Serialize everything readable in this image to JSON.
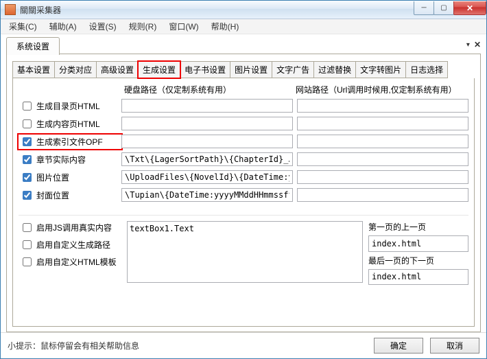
{
  "window": {
    "title": "關關采集器",
    "minimize": "─",
    "maximize": "▢",
    "close": "✕"
  },
  "menu": {
    "collect": "采集(C)",
    "assist": "辅助(A)",
    "settings": "设置(S)",
    "rules": "规则(R)",
    "window": "窗口(W)",
    "help": "帮助(H)"
  },
  "outer_tab": {
    "label": "系统设置",
    "dropdown": "▾",
    "close": "✕"
  },
  "inner_tabs": {
    "basic": "基本设置",
    "classify": "分类对应",
    "advanced": "高级设置",
    "generate": "生成设置",
    "ebook": "电子书设置",
    "image": "图片设置",
    "textad": "文字广告",
    "filter": "过滤替换",
    "text2img": "文字转图片",
    "logsel": "日志选择"
  },
  "headers": {
    "blank": "",
    "disk": "硬盘路径（仅定制系统有用）",
    "site": "网站路径（Url调用时候用,仅定制系统有用）"
  },
  "rows": {
    "gen_dir": {
      "label": "生成目录页HTML",
      "checked": false,
      "disk": "",
      "site": ""
    },
    "gen_content": {
      "label": "生成内容页HTML",
      "checked": false,
      "disk": "",
      "site": ""
    },
    "gen_index_opf": {
      "label": "生成索引文件OPF",
      "checked": true,
      "disk": "",
      "site": ""
    },
    "chapter_real": {
      "label": "章节实际内容",
      "checked": true,
      "disk": "\\Txt\\{LagerSortPath}\\{ChapterId}_Jie.Txt",
      "site": ""
    },
    "img_loc": {
      "label": "图片位置",
      "checked": true,
      "disk": "\\UploadFiles\\{NovelId}\\{DateTime:yyyyMMd",
      "site": ""
    },
    "cover_loc": {
      "label": "封面位置",
      "checked": true,
      "disk": "\\Tupian\\{DateTime:yyyyMMddHHmmssffff}.jp",
      "site": ""
    }
  },
  "lower": {
    "enable_js": {
      "label": "启用JS调用真实内容",
      "checked": false
    },
    "enable_custom_path": {
      "label": "启用自定义生成路径",
      "checked": false
    },
    "enable_custom_tpl": {
      "label": "启用自定义HTML模板",
      "checked": false
    },
    "textarea": "textBox1.Text",
    "first_prev_label": "第一页的上一页",
    "first_prev_value": "index.html",
    "last_next_label": "最后一页的下一页",
    "last_next_value": "index.html"
  },
  "footer": {
    "hint": "小提示：鼠标停留会有相关帮助信息",
    "ok": "确定",
    "cancel": "取消"
  }
}
